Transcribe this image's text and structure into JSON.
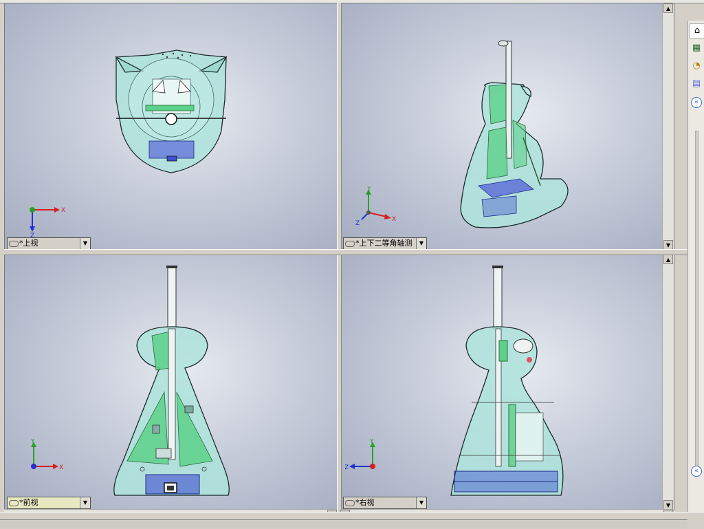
{
  "viewports": {
    "top": {
      "label": "*上视"
    },
    "dimetric": {
      "label": "*上下二等角轴测"
    },
    "front": {
      "label": "*前视"
    },
    "right": {
      "label": "*右视"
    }
  },
  "triads": {
    "top": {
      "x": "X",
      "z": "Z"
    },
    "dimetric": {
      "y": "Y",
      "x": "X",
      "z": "Z"
    },
    "front": {
      "y": "Y",
      "x": "X"
    },
    "right": {
      "y": "Y",
      "z": "Z"
    }
  },
  "task_pane": {
    "items": [
      {
        "icon": "home-icon",
        "glyph": "⌂"
      },
      {
        "icon": "design-library-icon",
        "glyph": "▦"
      },
      {
        "icon": "file-explorer-icon",
        "glyph": "◔"
      },
      {
        "icon": "view-palette-icon",
        "glyph": "▤"
      }
    ]
  },
  "colors": {
    "shell": "#aee3dc",
    "pcb": "#5dd18a",
    "battery": "#3f4fd0",
    "axis_x": "#d42020",
    "axis_y": "#2aa02a",
    "axis_z": "#2030d0"
  }
}
